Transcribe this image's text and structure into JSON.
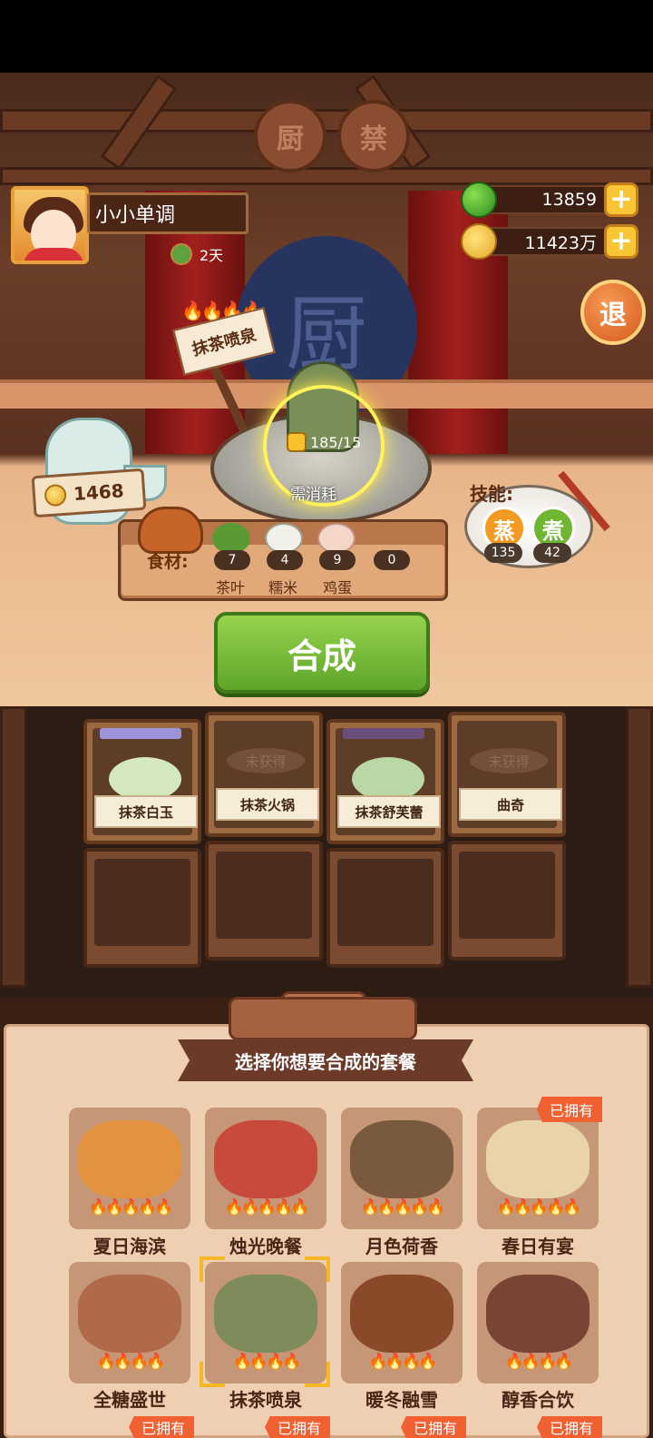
{
  "player": {
    "name": "小小单调",
    "days": "2天"
  },
  "resources": [
    {
      "icon": "apple-icon",
      "value": "13859",
      "plus": "+"
    },
    {
      "icon": "coin-icon",
      "value": "11423万",
      "plus": "+"
    }
  ],
  "exit_label": "退",
  "stage": {
    "plaque_chars": [
      "厨",
      "禁"
    ],
    "sign_text": "厨"
  },
  "recipe": {
    "sign": "抹茶喷泉",
    "flames": "🔥🔥🔥🔥",
    "cost": "185/15",
    "need_label": "需消耗",
    "price": "1468"
  },
  "skills": {
    "label": "技能:",
    "items": [
      {
        "name": "蒸",
        "count": "135",
        "color": "#f39a22"
      },
      {
        "name": "煮",
        "count": "42",
        "color": "#6fb632"
      }
    ]
  },
  "ingredients": {
    "label": "食材:",
    "items": [
      {
        "name": "茶叶",
        "count": "7",
        "color": "#5a9a33"
      },
      {
        "name": "糯米",
        "count": "4",
        "color": "#f1f1ea"
      },
      {
        "name": "鸡蛋",
        "count": "9",
        "color": "#f4d6c8"
      },
      {
        "name": "",
        "count": "0",
        "color": "transparent"
      }
    ]
  },
  "synth_label": "合成",
  "shelf": [
    {
      "name": "抹茶白玉",
      "status": "",
      "bar": "#9d93d8",
      "food": "#d3e8bd"
    },
    {
      "name": "抹茶火锅",
      "status": "未获得",
      "bar": "",
      "food": ""
    },
    {
      "name": "抹茶舒芙蕾",
      "status": "",
      "bar": "#6b4e7a",
      "food": "#b9d8a5"
    },
    {
      "name": "曲奇",
      "status": "未获得",
      "bar": "",
      "food": ""
    }
  ],
  "panel_title": "选择你想要合成的套餐",
  "sets": [
    {
      "name": "夏日海滨",
      "flames": "🔥🔥🔥🔥🔥",
      "owned": "",
      "color": "#e39340"
    },
    {
      "name": "烛光晚餐",
      "flames": "🔥🔥🔥🔥🔥",
      "owned": "",
      "color": "#c84a3c"
    },
    {
      "name": "月色荷香",
      "flames": "🔥🔥🔥🔥🔥",
      "owned": "",
      "color": "#7a5a3e"
    },
    {
      "name": "春日有宴",
      "flames": "🔥🔥🔥🔥🔥",
      "owned": "已拥有",
      "color": "#e9d3a8"
    },
    {
      "name": "全糖盛世",
      "flames": "🔥🔥🔥🔥",
      "owned": "",
      "color": "#b06a4a"
    },
    {
      "name": "抹茶喷泉",
      "flames": "🔥🔥🔥🔥",
      "owned": "",
      "color": "#7d8c5a"
    },
    {
      "name": "暖冬融雪",
      "flames": "🔥🔥🔥🔥",
      "owned": "",
      "color": "#8a4a2a"
    },
    {
      "name": "醇香合饮",
      "flames": "🔥🔥🔥🔥",
      "owned": "",
      "color": "#7a4434"
    }
  ],
  "bottom_owned": [
    "已拥有",
    "已拥有",
    "已拥有",
    "已拥有"
  ]
}
